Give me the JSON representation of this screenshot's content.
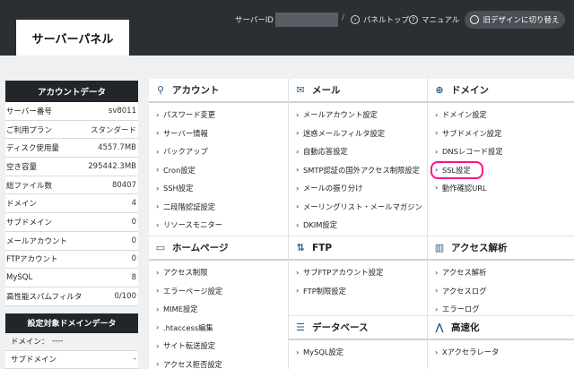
{
  "header": {
    "logo": "サーバーパネル",
    "server_id_label": "サーバーID",
    "separator": "/",
    "panel_top": "パネルトップ",
    "manual": "マニュアル",
    "old_design": "旧デザインに切り替え"
  },
  "account_data": {
    "title": "アカウントデータ",
    "rows": [
      {
        "label": "サーバー番号",
        "value": "sv8011"
      },
      {
        "label": "ご利用プラン",
        "value": "スタンダード"
      },
      {
        "label": "ディスク使用量",
        "value": "4557.7MB"
      },
      {
        "label": "空き容量",
        "value": "295442.3MB"
      },
      {
        "label": "総ファイル数",
        "value": "80407"
      },
      {
        "label": "ドメイン",
        "value": "4"
      },
      {
        "label": "サブドメイン",
        "value": "0"
      },
      {
        "label": "メールアカウント",
        "value": "0"
      },
      {
        "label": "FTPアカウント",
        "value": "0"
      },
      {
        "label": "MySQL",
        "value": "8"
      },
      {
        "label": "高性能スパムフィルタ",
        "value": "0/100"
      }
    ]
  },
  "domain_data": {
    "title": "設定対象ドメインデータ",
    "rows": [
      {
        "label": "ドメイン：",
        "value": "----"
      },
      {
        "label": "サブドメイン",
        "value": "-"
      }
    ]
  },
  "sections": {
    "account": {
      "title": "アカウント",
      "items": [
        "パスワード変更",
        "サーバー情報",
        "バックアップ",
        "Cron設定",
        "SSH設定",
        "二段階認証設定",
        "リソースモニター"
      ]
    },
    "mail": {
      "title": "メール",
      "items": [
        "メールアカウント設定",
        "迷惑メールフィルタ設定",
        "自動応答設定",
        "SMTP認証の国外アクセス制限設定",
        "メールの振り分け",
        "メーリングリスト・メールマガジン",
        "DKIM設定"
      ]
    },
    "domain": {
      "title": "ドメイン",
      "items": [
        "ドメイン設定",
        "サブドメイン設定",
        "DNSレコード設定",
        "SSL設定",
        "動作確認URL"
      ]
    },
    "homepage": {
      "title": "ホームページ",
      "items": [
        "アクセス制限",
        "エラーページ設定",
        "MIME設定",
        ".htaccess編集",
        "サイト転送設定",
        "アクセス拒否設定"
      ]
    },
    "ftp": {
      "title": "FTP",
      "items": [
        "サブFTPアカウント設定",
        "FTP制限設定"
      ]
    },
    "access": {
      "title": "アクセス解析",
      "items": [
        "アクセス解析",
        "アクセスログ",
        "エラーログ"
      ]
    },
    "database": {
      "title": "データベース",
      "items": [
        "MySQL設定"
      ]
    },
    "speed": {
      "title": "高速化",
      "items": [
        "Xアクセラレータ"
      ]
    }
  },
  "colors": {
    "highlight": "#ff0d8a",
    "header_bg": "#2b2e33",
    "icon_blue": "#2c5a8c"
  }
}
